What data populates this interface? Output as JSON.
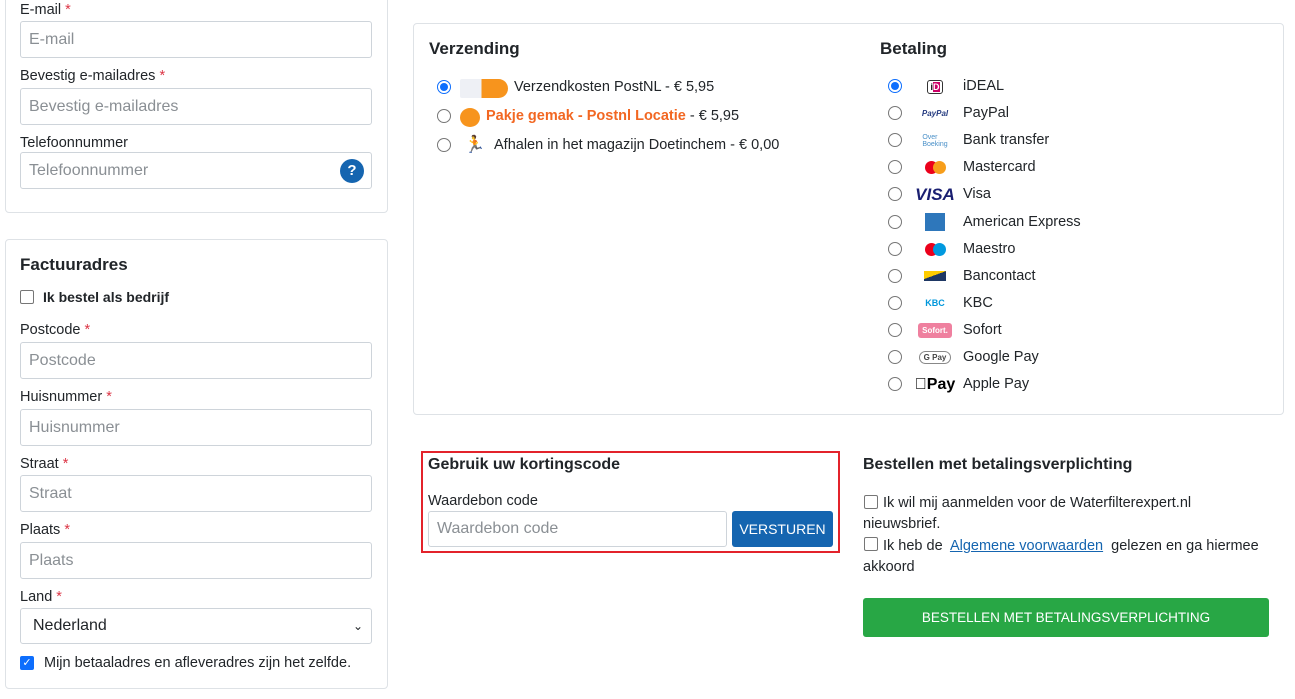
{
  "contact": {
    "email_label": "E-mail",
    "email_placeholder": "E-mail",
    "confirm_label": "Bevestig e-mailadres",
    "confirm_placeholder": "Bevestig e-mailadres",
    "phone_label": "Telefoonnummer",
    "phone_placeholder": "Telefoonnummer",
    "required_mark": "*",
    "help_icon": "?"
  },
  "billing": {
    "title": "Factuuradres",
    "company_checkbox": "Ik bestel als bedrijf",
    "postcode_label": "Postcode",
    "postcode_placeholder": "Postcode",
    "house_label": "Huisnummer",
    "house_placeholder": "Huisnummer",
    "street_label": "Straat",
    "street_placeholder": "Straat",
    "city_label": "Plaats",
    "city_placeholder": "Plaats",
    "country_label": "Land",
    "country_value": "Nederland",
    "same_address": "Mijn betaaladres en afleveradres zijn het zelfde.",
    "same_address_checked": true
  },
  "shipping": {
    "title": "Verzending",
    "options": [
      {
        "label": "Verzendkosten PostNL - € 5,95",
        "selected": true,
        "icon": "postnl-logo"
      },
      {
        "label_highlight": "Pakje gemak - Postnl Locatie",
        "label_rest": " - € 5,95",
        "selected": false,
        "icon": "postnl-logo",
        "highlight_color": "#f26722"
      },
      {
        "label": "Afhalen in het magazijn Doetinchem - € 0,00",
        "selected": false,
        "icon": "pickup-person-icon"
      }
    ]
  },
  "payment": {
    "title": "Betaling",
    "methods": [
      {
        "label": "iDEAL",
        "selected": true
      },
      {
        "label": "PayPal"
      },
      {
        "label": "Bank transfer"
      },
      {
        "label": "Mastercard"
      },
      {
        "label": "Visa"
      },
      {
        "label": "American Express"
      },
      {
        "label": "Maestro"
      },
      {
        "label": "Bancontact"
      },
      {
        "label": "KBC"
      },
      {
        "label": "Sofort"
      },
      {
        "label": "Google Pay"
      },
      {
        "label": "Apple Pay"
      }
    ],
    "logo_texts": {
      "ideal": "iD",
      "paypal": "PayPal",
      "bank": "Over Boeking",
      "visa": "VISA",
      "kbc": "KBC",
      "sofort": "Sofort.",
      "gpay": "G Pay",
      "applepay": "Pay"
    }
  },
  "coupon": {
    "title": "Gebruik uw kortingscode",
    "label": "Waardebon code",
    "placeholder": "Waardebon code",
    "button": "VERSTUREN",
    "highlight_color": "#e3232b"
  },
  "order": {
    "title": "Bestellen met betalingsverplichting",
    "newsletter": "Ik wil mij aanmelden voor de Waterfilterexpert.nl nieuwsbrief.",
    "terms_pre": "Ik heb de",
    "terms_link": "Algemene voorwaarden",
    "terms_post": "gelezen en ga hiermee akkoord",
    "button": "BESTELLEN MET BETALINGSVERPLICHTING",
    "button_color": "#28a745"
  }
}
